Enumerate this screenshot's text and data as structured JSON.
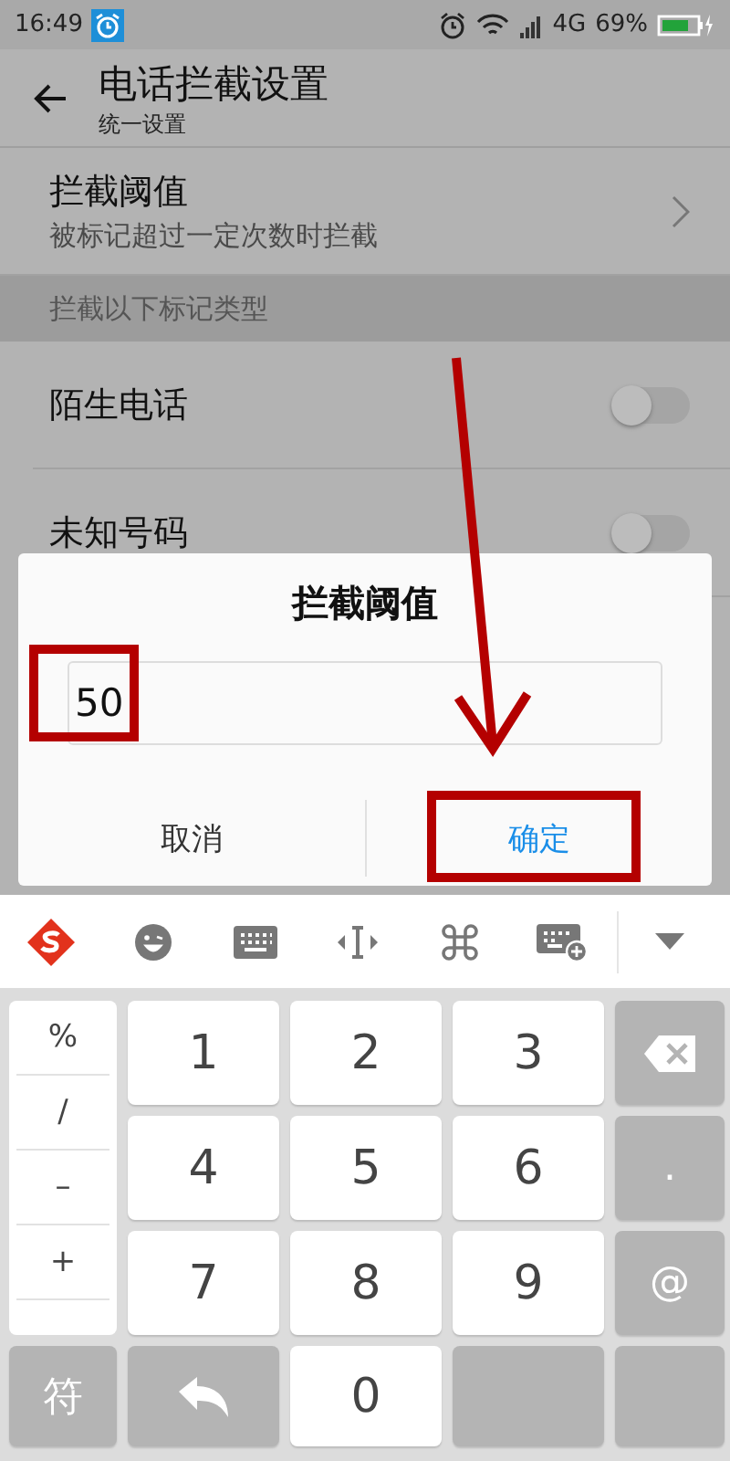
{
  "status_bar": {
    "time": "16:49",
    "network": "4G",
    "battery": "69%"
  },
  "app_bar": {
    "title": "电话拦截设置",
    "subtitle": "统一设置"
  },
  "settings": [
    {
      "kind": "link",
      "title": "拦截阈值",
      "subtitle": "被标记超过一定次数时拦截"
    },
    {
      "kind": "header",
      "title": "拦截以下标记类型"
    },
    {
      "kind": "toggle",
      "title": "陌生电话",
      "on": false
    },
    {
      "kind": "toggle",
      "title": "未知号码",
      "on": false
    }
  ],
  "dialog": {
    "title": "拦截阈值",
    "value": "50",
    "buttons": [
      {
        "label": "取消",
        "primary": false
      },
      {
        "label": "确定",
        "primary": true
      }
    ]
  },
  "keyboard": {
    "side_keys": [
      "%",
      "/",
      "–",
      "+"
    ],
    "keys": [
      {
        "kind": "digit",
        "label": "1"
      },
      {
        "kind": "digit",
        "label": "2"
      },
      {
        "kind": "digit",
        "label": "3"
      },
      {
        "kind": "backspace"
      },
      {
        "kind": "digit",
        "label": "4"
      },
      {
        "kind": "digit",
        "label": "5"
      },
      {
        "kind": "digit",
        "label": "6"
      },
      {
        "kind": "function",
        "label": "."
      },
      {
        "kind": "digit",
        "label": "7"
      },
      {
        "kind": "digit",
        "label": "8"
      },
      {
        "kind": "digit",
        "label": "9"
      },
      {
        "kind": "function",
        "label": "@"
      }
    ],
    "bottom_keys": [
      {
        "kind": "function",
        "label": "符"
      },
      {
        "kind": "undo"
      },
      {
        "kind": "digit",
        "label": "0"
      },
      {
        "kind": "space"
      },
      {
        "kind": "enter"
      }
    ]
  },
  "annotations": {
    "value_box": true,
    "confirm_box": true,
    "arrow": true
  }
}
